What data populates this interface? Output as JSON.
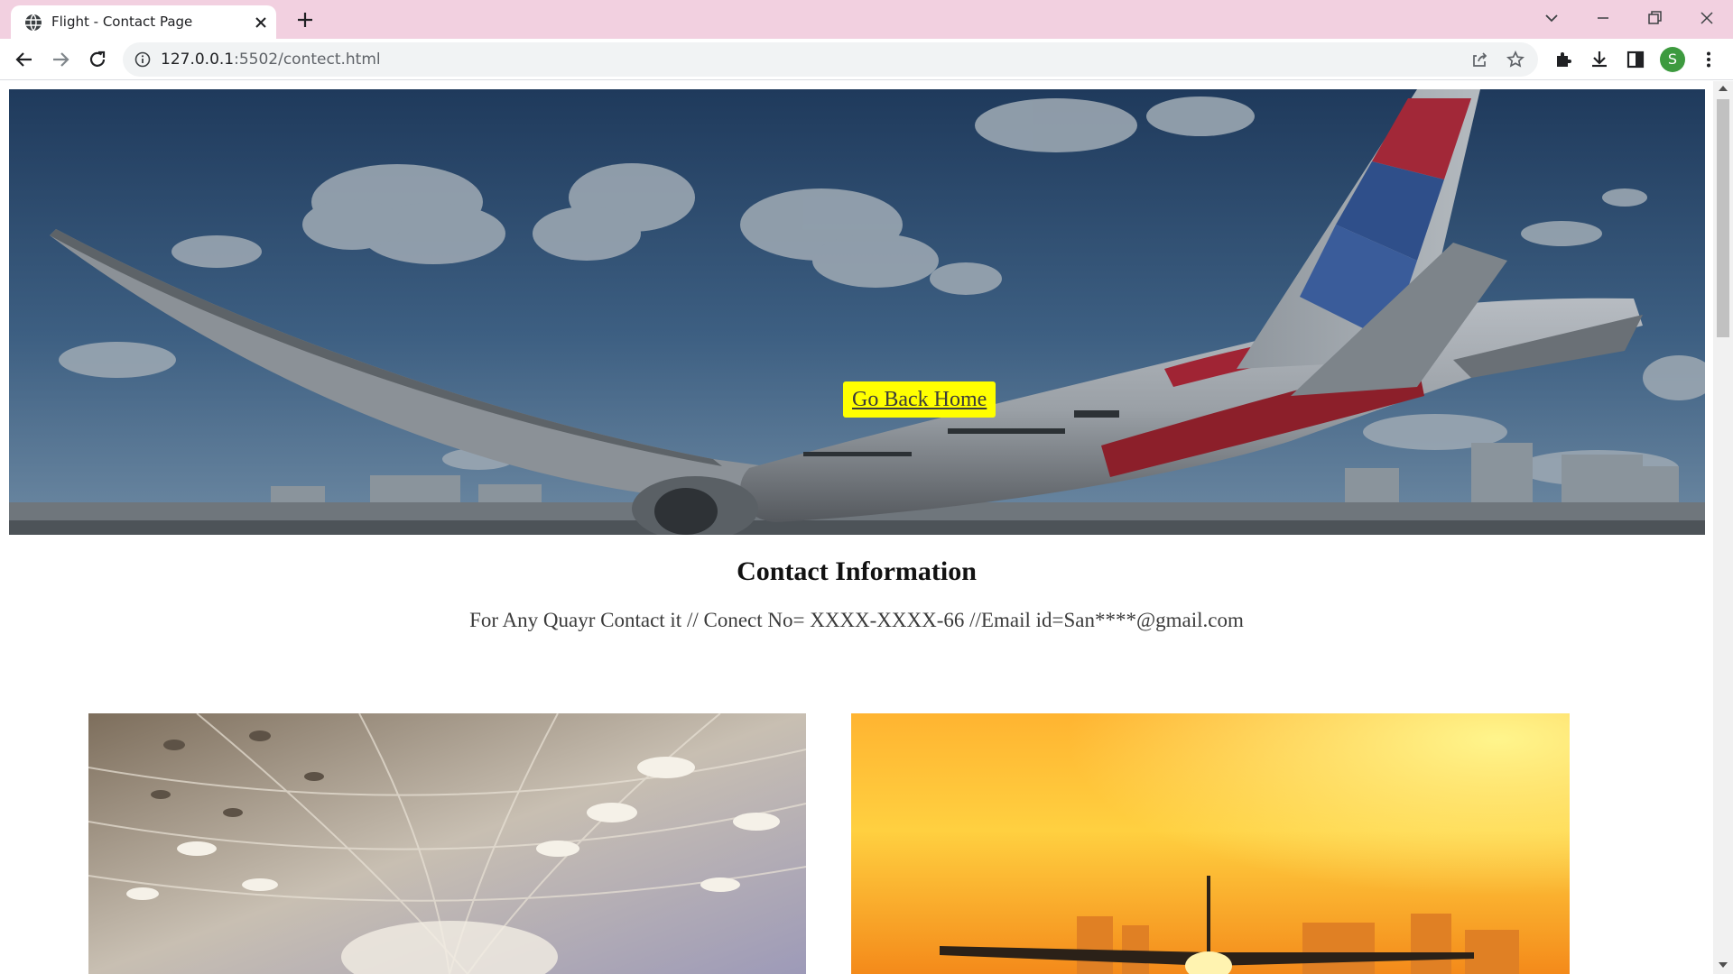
{
  "browser": {
    "tab": {
      "title": "Flight - Contact Page"
    },
    "address_bar": {
      "host": "127.0.0.1",
      "path": ":5502/contect.html"
    },
    "profile_initial": "S",
    "icons": [
      "globe-icon",
      "close-icon",
      "plus-icon",
      "chevron-down-icon",
      "minimize-icon",
      "restore-icon",
      "window-close-icon",
      "back-arrow-icon",
      "forward-arrow-icon",
      "reload-icon",
      "info-icon",
      "share-icon",
      "star-icon",
      "extensions-icon",
      "download-icon",
      "side-panel-icon",
      "kebab-menu-icon"
    ],
    "accent_color": "#f2d0e0",
    "avatar_color": "#3d9a3f"
  },
  "page": {
    "hero": {
      "button_label": "Go Back Home",
      "button_color": "#ffff00"
    },
    "contact": {
      "heading": "Contact Information",
      "text": "For Any Quayr Contact it // Conect No= XXXX-XXXX-66 //Email id=San****@gmail.com"
    },
    "photos": {
      "left": "airport-terminal-ceiling",
      "right": "airplane-sunset"
    }
  }
}
